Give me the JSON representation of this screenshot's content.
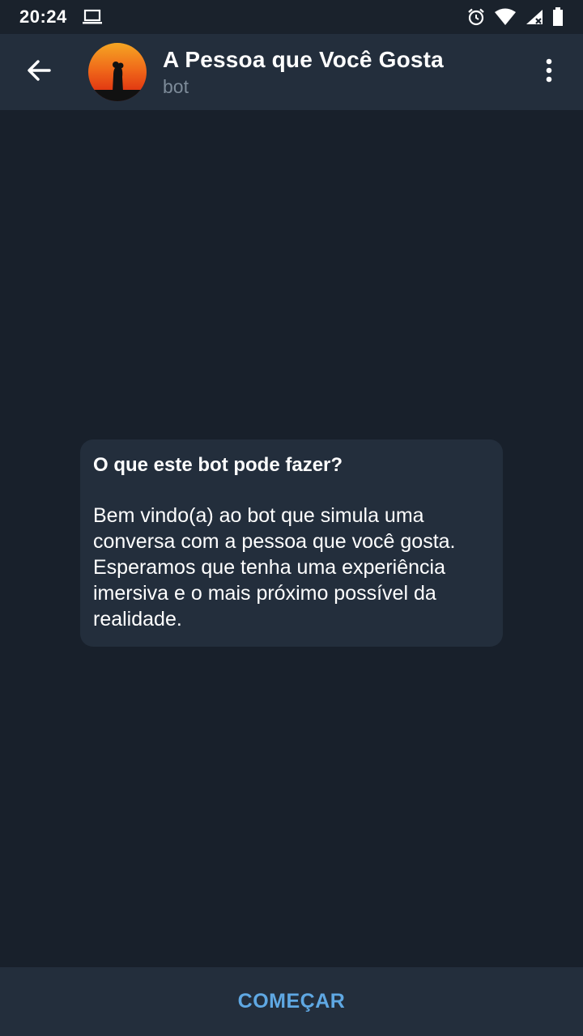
{
  "status_bar": {
    "time": "20:24",
    "icons": [
      "laptop-icon",
      "alarm-icon",
      "wifi-icon",
      "signal-icon",
      "battery-icon"
    ]
  },
  "header": {
    "back_icon": "arrow-left-icon",
    "title": "A Pessoa que Você Gosta",
    "subtitle": "bot",
    "menu_icon": "more-vertical-icon"
  },
  "bot_info": {
    "heading": "O que este bot pode fazer?",
    "description": "Bem vindo(a) ao bot que simula uma\nconversa com a pessoa que você gosta.\nEsperamos que tenha uma experiência\nimersiva e o mais próximo possível da\nrealidade."
  },
  "bottom": {
    "start_label": "COMEÇAR"
  },
  "colors": {
    "background": "#18202b",
    "header": "#232e3c",
    "card": "#232e3c",
    "accent": "#5fa8e3",
    "subtitle": "#7d8b99"
  }
}
